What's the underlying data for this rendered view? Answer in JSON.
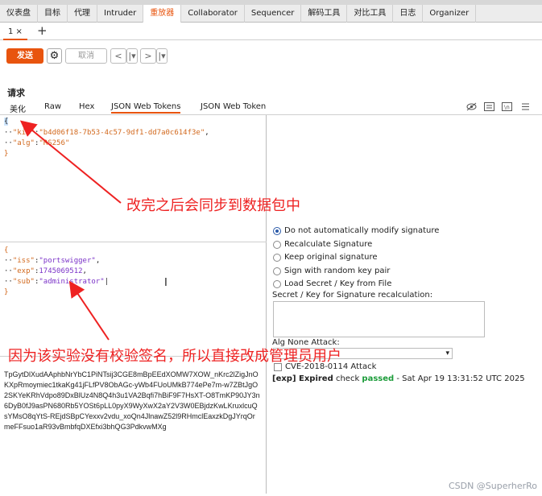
{
  "tabs": [
    "仪表盘",
    "目标",
    "代理",
    "Intruder",
    "重放器",
    "Collaborator",
    "Sequencer",
    "解码工具",
    "对比工具",
    "日志",
    "Organizer"
  ],
  "active_tab": "重放器",
  "subtab": {
    "label": "1 ×",
    "plus": "+"
  },
  "toolbar": {
    "send": "发送",
    "gear": "⚙",
    "cancel": "取消",
    "back": "<",
    "back_drop": "|▾",
    "fwd": ">",
    "fwd_drop": "|▾"
  },
  "request": {
    "title": "请求"
  },
  "view_tabs": [
    "美化",
    "Raw",
    "Hex",
    "JSON Web Tokens",
    "JSON Web Token"
  ],
  "view_icons": [
    "eye-off-icon",
    "list-icon",
    "newline-icon",
    "menu-icon"
  ],
  "header_json": {
    "open": "{",
    "kid_key": "\"kid\"",
    "kid_val": "\"b4d06f18-7b53-4c57-9df1-dd7a0c614f3e\"",
    "alg_key": "\"alg\"",
    "alg_val": "\"RS256\"",
    "close": "}"
  },
  "payload_json": {
    "open": "{",
    "iss_key": "\"iss\"",
    "iss_val": "\"portswigger\"",
    "exp_key": "\"exp\"",
    "exp_val": "1745069512",
    "sub_key": "\"sub\"",
    "sub_val": "\"administrator\"",
    "close": "}"
  },
  "signature_text": "TpGytDlXudAAphbNrYbC1PiNTsij3CGE8mBpEEdXOMW7XOW_nKrc2lZigJnOKXpRmoymiec1tkaKg41jFLfPV8ObAGc-yWb4FUoUMkB774ePe7m-w7ZBtJgO2SKYeKRhVdpo89DxBlUz4N8Q4h3u1VA2Bqfi7hBiF9F7HsXT-O8TmKP90JY3n6DyB0fJ9asPN680Rb5YOSt6pLL0pyX9WyXwX2aY2V3W0EBjdzKwLKruxlcuQsYMsO8qYtS-REjdSBpCYexxv2vdu_xoQn4JlnawZ52l9RHmclEaxzkDgJYrqOrmeFFsuo1aR93vBmbfqDXEfxi3bhQG3PdkvwMXg",
  "signature_options": [
    {
      "label": "Do not automatically modify signature",
      "checked": true
    },
    {
      "label": "Recalculate Signature",
      "checked": false
    },
    {
      "label": "Keep original signature",
      "checked": false
    },
    {
      "label": "Sign with random key pair",
      "checked": false
    },
    {
      "label": "Load Secret / Key from File",
      "checked": false
    }
  ],
  "secret_label": "Secret / Key for Signature recalculation:",
  "alg_none_label": "Alg None Attack:",
  "cve_label": "CVE-2018-0114 Attack",
  "status": {
    "prefix": "[exp] Expired",
    "check": "check",
    "passed": "passed",
    "suffix": "- Sat Apr 19 13:31:52 UTC 2025"
  },
  "annotations": {
    "top": "改完之后会同步到数据包中",
    "bottom": "因为该实验没有校验签名，所以直接改成管理员用户"
  },
  "watermark": "CSDN @SuperherRo",
  "colors": {
    "accent": "#e8540e",
    "annotation": "#e22222",
    "passed": "#1c9c3a"
  }
}
